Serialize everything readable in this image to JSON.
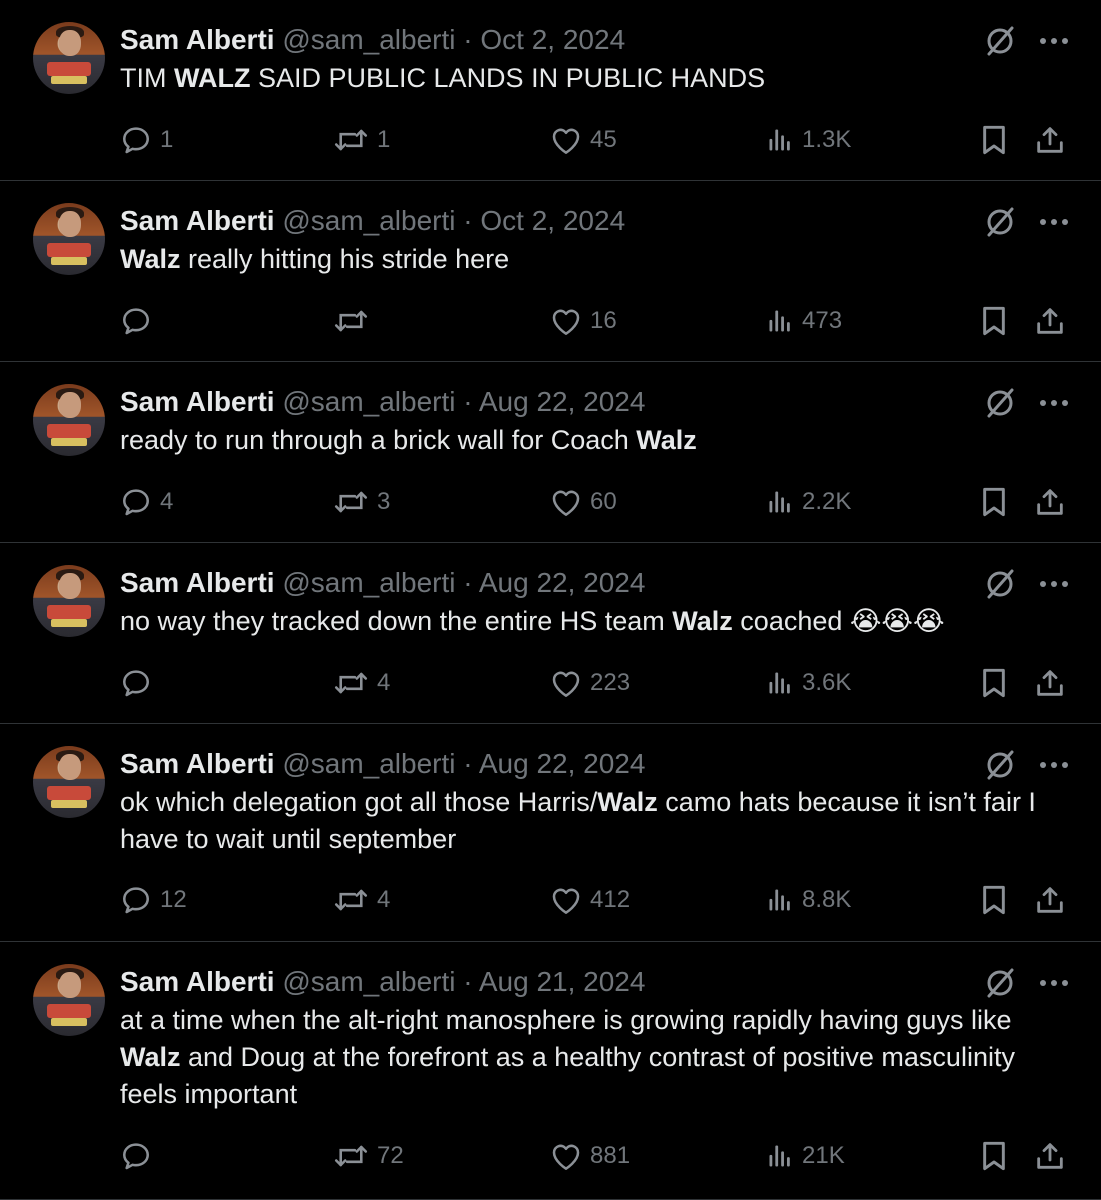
{
  "author": {
    "name": "Sam Alberti",
    "handle": "@sam_alberti"
  },
  "icons": {
    "grok": "grok-icon",
    "more": "more-icon",
    "reply": "reply-icon",
    "repost": "repost-icon",
    "like": "like-icon",
    "views": "views-icon",
    "bookmark": "bookmark-icon",
    "share": "share-icon"
  },
  "tweets": [
    {
      "date": "Oct 2, 2024",
      "text_segments": [
        {
          "t": "TIM ",
          "b": false
        },
        {
          "t": "WALZ",
          "b": true
        },
        {
          "t": " SAID PUBLIC LANDS IN PUBLIC HANDS",
          "b": false
        }
      ],
      "replies": "1",
      "reposts": "1",
      "likes": "45",
      "views": "1.3K"
    },
    {
      "date": "Oct 2, 2024",
      "text_segments": [
        {
          "t": "Walz",
          "b": true
        },
        {
          "t": " really hitting his stride here",
          "b": false
        }
      ],
      "replies": "",
      "reposts": "",
      "likes": "16",
      "views": "473"
    },
    {
      "date": "Aug 22, 2024",
      "text_segments": [
        {
          "t": "ready to run through a brick wall for Coach ",
          "b": false
        },
        {
          "t": "Walz",
          "b": true
        }
      ],
      "replies": "4",
      "reposts": "3",
      "likes": "60",
      "views": "2.2K"
    },
    {
      "date": "Aug 22, 2024",
      "text_segments": [
        {
          "t": "no way they tracked down the entire HS team ",
          "b": false
        },
        {
          "t": "Walz",
          "b": true
        },
        {
          "t": " coached 😭😭😭",
          "b": false
        }
      ],
      "replies": "",
      "reposts": "4",
      "likes": "223",
      "views": "3.6K"
    },
    {
      "date": "Aug 22, 2024",
      "text_segments": [
        {
          "t": "ok which delegation got all those Harris/",
          "b": false
        },
        {
          "t": "Walz",
          "b": true
        },
        {
          "t": " camo hats because it isn’t fair I have to wait until september",
          "b": false
        }
      ],
      "replies": "12",
      "reposts": "4",
      "likes": "412",
      "views": "8.8K"
    },
    {
      "date": "Aug 21, 2024",
      "text_segments": [
        {
          "t": "at a time when the alt-right manosphere is growing rapidly having guys like ",
          "b": false
        },
        {
          "t": "Walz",
          "b": true
        },
        {
          "t": " and Doug at the forefront as a healthy contrast of positive masculinity feels important",
          "b": false
        }
      ],
      "replies": "",
      "reposts": "72",
      "likes": "881",
      "views": "21K"
    }
  ]
}
